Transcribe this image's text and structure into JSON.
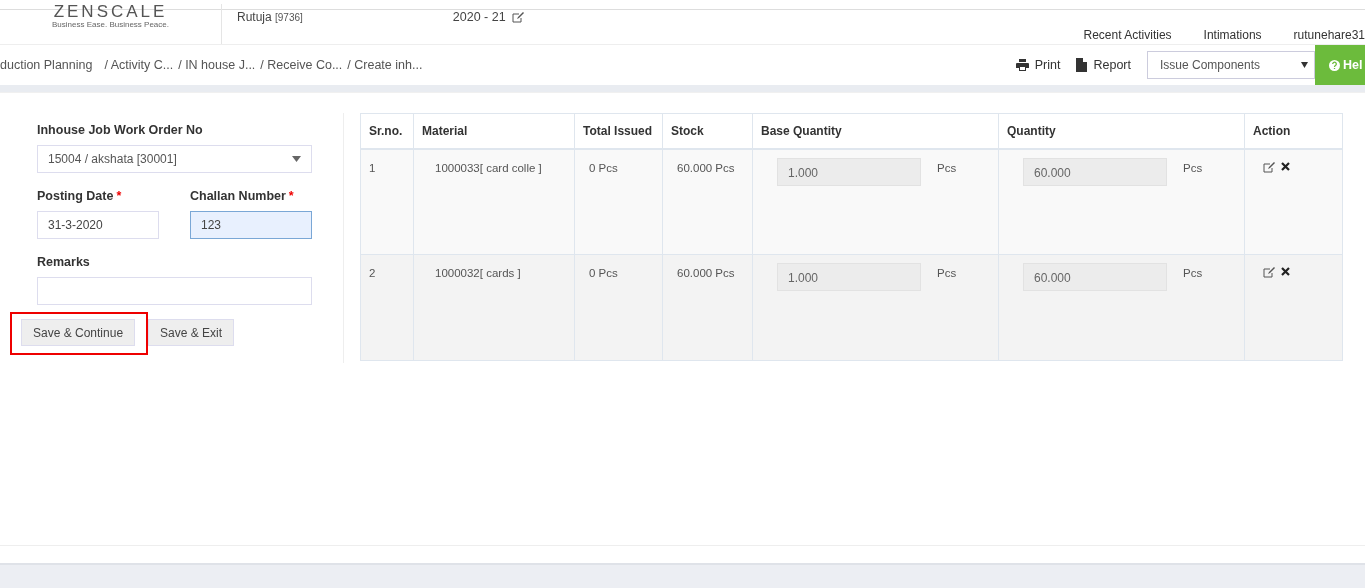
{
  "header": {
    "logo": {
      "name": "ZENSCALE",
      "tagline": "Business Ease. Business Peace."
    },
    "user": "Rutuja",
    "user_code": "[9736]",
    "year": "2020 - 21",
    "nav": [
      "Recent Activities",
      "Intimations",
      "rutunehare31"
    ]
  },
  "breadcrumb": [
    "duction Planning",
    "/ Activity C...",
    "/ IN house J...",
    "/ Receive Co...",
    "/ Create inh..."
  ],
  "toolbar": {
    "print": "Print",
    "report": "Report",
    "select": "Issue Components",
    "help": "Hel"
  },
  "form": {
    "order_label": "Inhouse Job Work Order No",
    "order_value": "15004 / akshata [30001]",
    "fields": [
      {
        "label": "Posting Date",
        "required_mark": "*",
        "value": "31-3-2020",
        "focused": false
      },
      {
        "label": "Challan Number",
        "required_mark": "*",
        "value": "123",
        "focused": true
      }
    ],
    "remarks_label": "Remarks",
    "buttons": [
      {
        "label": "Save & Continue",
        "highlighted": true
      },
      {
        "label": "Save & Exit",
        "highlighted": false
      }
    ]
  },
  "table": {
    "columns": [
      "Sr.no.",
      "Material",
      "Total Issued",
      "Stock",
      "Base Quantity",
      "Quantity",
      "Action"
    ],
    "rows": [
      {
        "sr": "1",
        "material": "1000033[ card colle ]",
        "total_issued": "0 Pcs",
        "stock": "60.000 Pcs",
        "base_quantity": "1.000",
        "base_unit": "Pcs",
        "quantity": "60.000",
        "unit": "Pcs"
      },
      {
        "sr": "2",
        "material": "1000032[ cards ]",
        "total_issued": "0 Pcs",
        "stock": "60.000 Pcs",
        "base_quantity": "1.000",
        "base_unit": "Pcs",
        "quantity": "60.000",
        "unit": "Pcs"
      }
    ]
  }
}
